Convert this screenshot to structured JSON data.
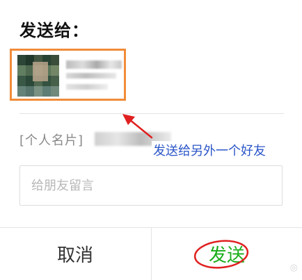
{
  "dialog": {
    "title": "发送给：",
    "card_label": "[个人名片]",
    "message_placeholder": "给朋友留言",
    "cancel_label": "取消",
    "send_label": "发送"
  },
  "annotation": {
    "text": "发送给另外一个好友",
    "arrow_color": "#e02020",
    "text_color": "#2b56c9",
    "highlight_box_color": "#f08c3a",
    "circle_color": "#e02020"
  },
  "colors": {
    "send_green": "#1aad19",
    "text_gray": "#888888"
  }
}
